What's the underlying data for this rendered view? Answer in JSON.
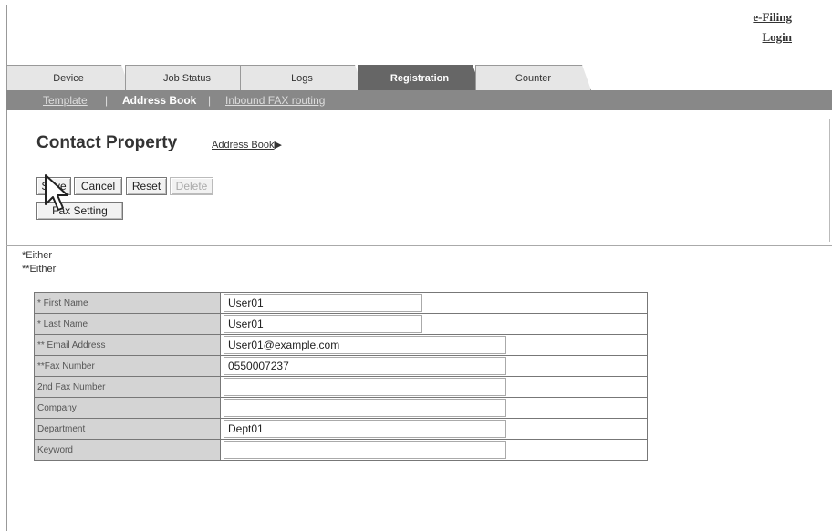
{
  "top_links": {
    "efiling": "e-Filing",
    "login": "Login"
  },
  "tabs": [
    {
      "label": "Device",
      "active": false
    },
    {
      "label": "Job Status",
      "active": false
    },
    {
      "label": "Logs",
      "active": false
    },
    {
      "label": "Registration",
      "active": true
    },
    {
      "label": "Counter",
      "active": false
    }
  ],
  "subnav": {
    "template": "Template",
    "sep1": "|",
    "address_book": "Address Book",
    "sep2": "|",
    "inbound_fax": "Inbound FAX routing"
  },
  "page": {
    "title": "Contact Property",
    "breadcrumb": "Address Book",
    "breadcrumb_arrow": "▶"
  },
  "buttons": {
    "save": "Save",
    "cancel": "Cancel",
    "reset": "Reset",
    "delete": "Delete",
    "fax_setting": "Fax Setting"
  },
  "notes": [
    "*Either",
    "**Either"
  ],
  "fields": [
    {
      "label": "* First Name",
      "value": "User01"
    },
    {
      "label": "* Last Name",
      "value": "User01"
    },
    {
      "label": "** Email Address",
      "value": "User01@example.com"
    },
    {
      "label": "**Fax Number",
      "value": "0550007237"
    },
    {
      "label": "2nd Fax Number",
      "value": ""
    },
    {
      "label": "Company",
      "value": ""
    },
    {
      "label": "Department",
      "value": "Dept01"
    },
    {
      "label": "Keyword",
      "value": ""
    }
  ]
}
